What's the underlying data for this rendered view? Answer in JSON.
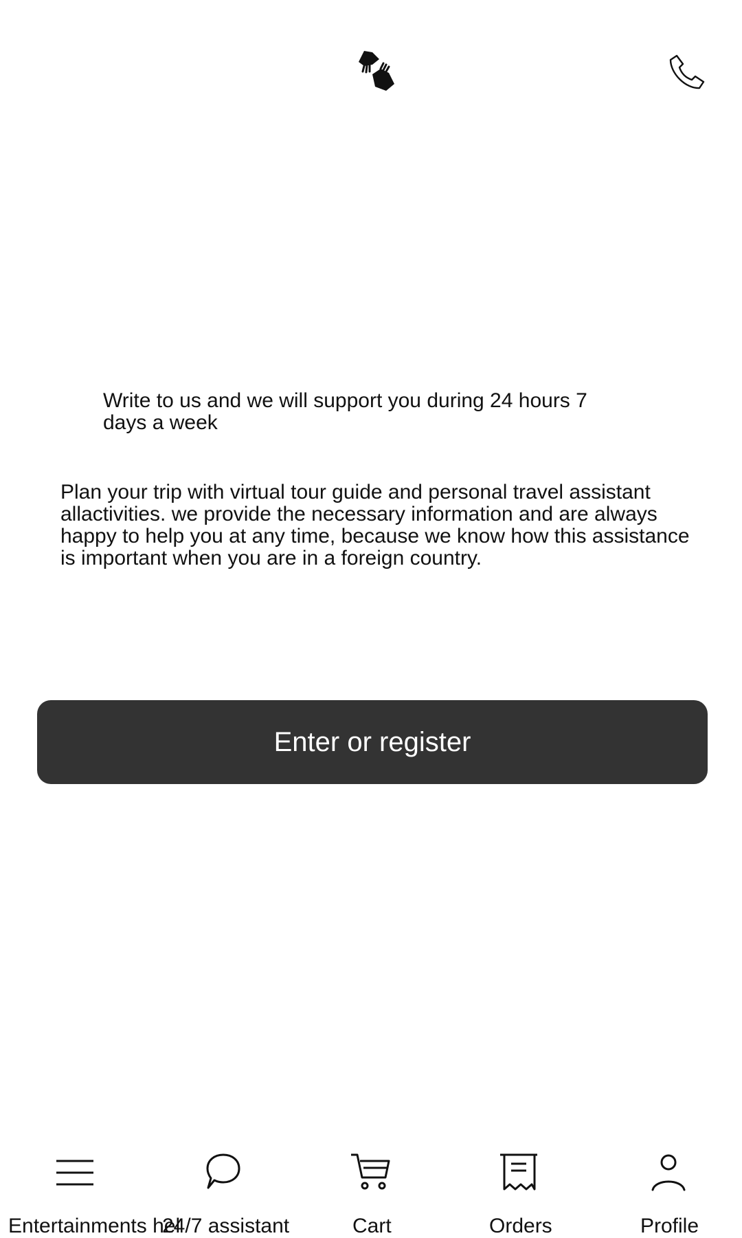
{
  "header": {
    "logo_icon": "helping-hands-icon",
    "phone_icon": "phone-icon"
  },
  "content": {
    "support_text": "Write to us and we will support you during 24 hours 7 days a week",
    "intro_text": "Plan your trip with virtual tour guide and personal travel assistant allactivities. we provide the necessary information and are always happy to help you at any time, because we know how this assistance is important when you are in a foreign country."
  },
  "actions": {
    "enter_register_label": "Enter or register"
  },
  "bottom_nav": {
    "items": [
      {
        "label": "Entertainments hel",
        "icon": "menu-icon"
      },
      {
        "label": "24/7 assistant",
        "icon": "chat-icon"
      },
      {
        "label": "Cart",
        "icon": "cart-icon"
      },
      {
        "label": "Orders",
        "icon": "receipt-icon"
      },
      {
        "label": "Profile",
        "icon": "profile-icon"
      }
    ]
  }
}
